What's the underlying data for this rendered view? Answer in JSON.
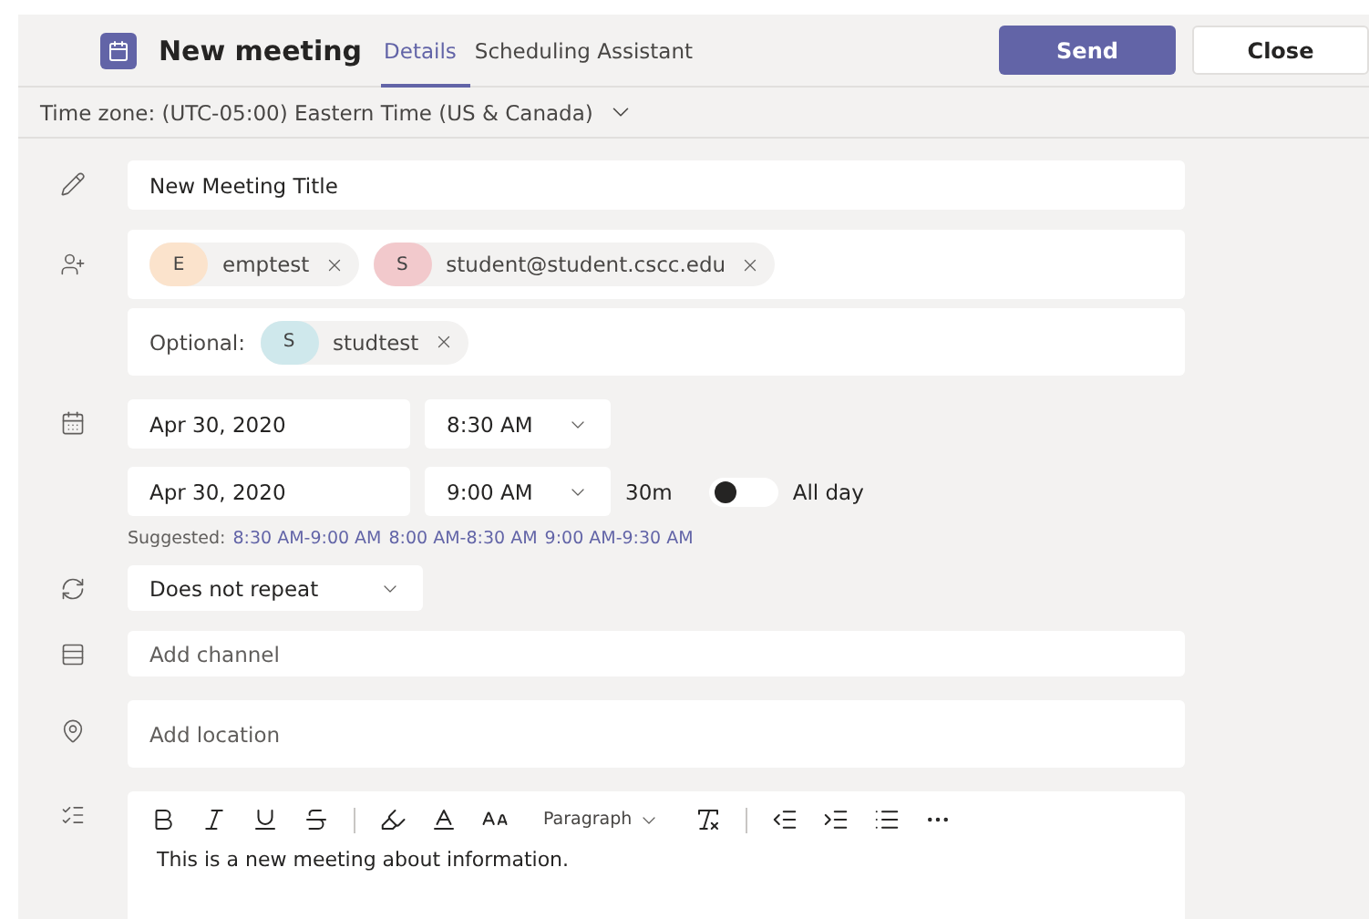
{
  "header": {
    "title": "New meeting",
    "tabs": [
      {
        "label": "Details",
        "selected": true
      },
      {
        "label": "Scheduling Assistant",
        "selected": false
      }
    ],
    "buttons": [
      {
        "label": "Send",
        "kind": "primary"
      },
      {
        "label": "Close",
        "kind": "secondary"
      }
    ]
  },
  "timezone": "Time zone: (UTC-05:00) Eastern Time (US & Canada)",
  "title_field": {
    "value": "New Meeting Title"
  },
  "attendees": {
    "required": [
      {
        "initial": "E",
        "name": "emptest",
        "color": "#fbe3cc"
      },
      {
        "initial": "S",
        "name": "student@student.cscc.edu",
        "color": "#f2c9cc"
      }
    ],
    "optional_label": "Optional:",
    "optional": [
      {
        "initial": "S",
        "name": "studtest",
        "color": "#cfe8ec"
      }
    ]
  },
  "start": {
    "date": "Apr 30, 2020",
    "time": "8:30 AM"
  },
  "end": {
    "date": "Apr 30, 2020",
    "time": "9:00 AM",
    "duration": "30m"
  },
  "all_day": {
    "label": "All day",
    "on": false
  },
  "suggested": {
    "label": "Suggested:",
    "slots": [
      "8:30 AM-9:00 AM",
      "8:00 AM-8:30 AM",
      "9:00 AM-9:30 AM"
    ]
  },
  "repeat": {
    "value": "Does not repeat"
  },
  "channel": {
    "placeholder": "Add channel"
  },
  "location": {
    "placeholder": "Add location"
  },
  "editor": {
    "paragraph_label": "Paragraph",
    "body": "This is a new meeting about information."
  }
}
